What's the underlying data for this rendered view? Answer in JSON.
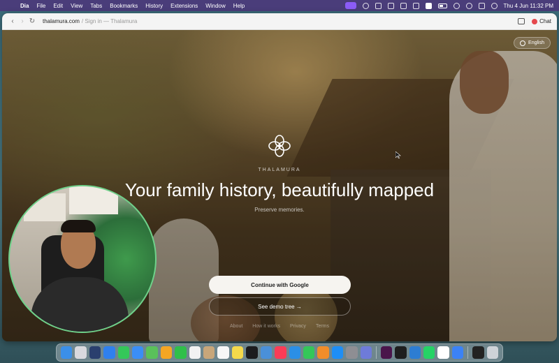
{
  "menubar": {
    "app_name": "Dia",
    "menus": [
      "File",
      "Edit",
      "View",
      "Tabs",
      "Bookmarks",
      "History",
      "Extensions",
      "Window",
      "Help"
    ],
    "clock": "Thu 4 Jun  11:32 PM"
  },
  "browser": {
    "url_domain": "thalamura.com",
    "url_title": "/ Sign in — Thalamura",
    "chat_label": "Chat"
  },
  "page": {
    "language_label": "English",
    "brand": "THALAMURA",
    "headline": "Your family history, beautifully mapped",
    "subline": "Preserve memories.",
    "google_button": "Continue with Google",
    "demo_button": "See demo tree →",
    "footer_links": [
      "About",
      "How it works",
      "Privacy",
      "Terms"
    ]
  },
  "colors": {
    "menubar": "#4a3d7a",
    "accent_green": "#6fd18a",
    "chat_red": "#e5484d"
  },
  "dock": {
    "icons": [
      "finder-icon",
      "launchpad-icon",
      "mail-icon",
      "safari-icon",
      "messages-icon",
      "mail2-icon",
      "maps-icon",
      "photos-icon",
      "facetime-icon",
      "calendar-icon",
      "contacts-icon",
      "reminders-icon",
      "notes-icon",
      "tv-icon",
      "freeform-icon",
      "music-icon",
      "keynote-icon",
      "numbers-icon",
      "pages-icon",
      "appstore-icon",
      "settings-icon",
      "preview-icon",
      "slack-icon",
      "figma-icon",
      "vscode-icon",
      "whatsapp-icon",
      "notion-icon",
      "dia-icon",
      "iphone-mirroring-icon",
      "trash-icon"
    ]
  }
}
